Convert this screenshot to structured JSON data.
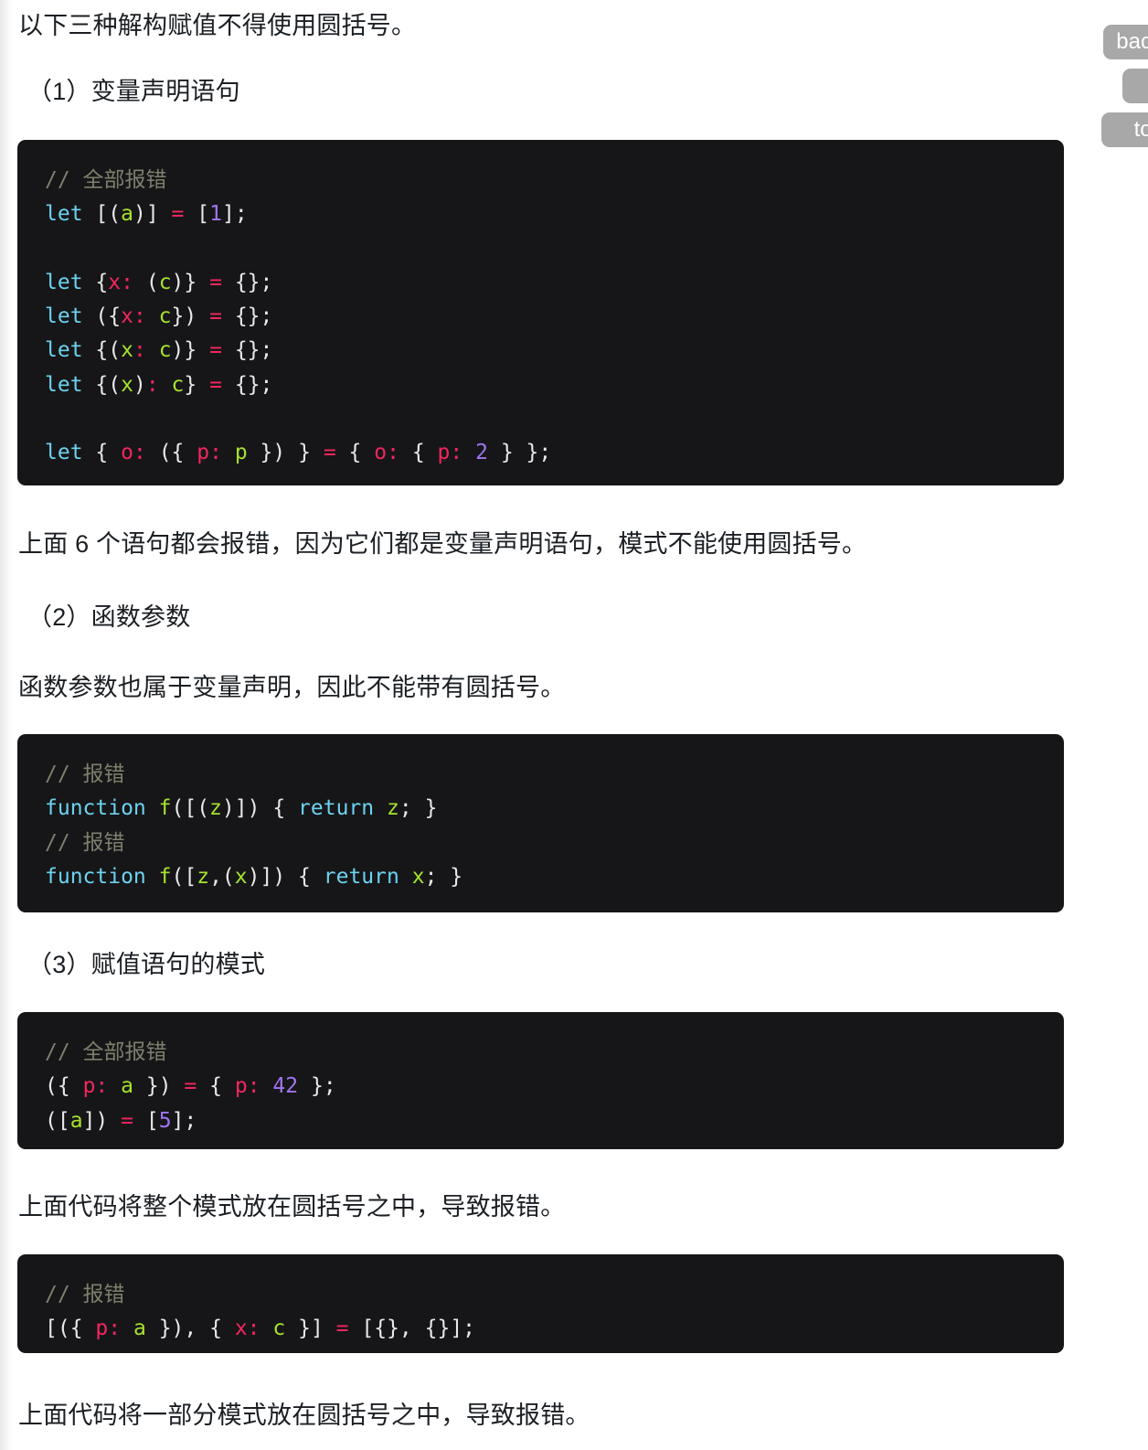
{
  "page": {
    "intro": "以下三种解构赋值不得使用圆括号。",
    "section1_heading": "（1）变量声明语句",
    "para_after_code1": "上面 6 个语句都会报错，因为它们都是变量声明语句，模式不能使用圆括号。",
    "section2_heading": "（2）函数参数",
    "para_before_code2": "函数参数也属于变量声明，因此不能带有圆括号。",
    "section3_heading": "（3）赋值语句的模式",
    "para_after_code3": "上面代码将整个模式放在圆括号之中，导致报错。",
    "para_after_code4": "上面代码将一部分模式放在圆括号之中，导致报错。"
  },
  "code_blocks": {
    "block1": {
      "comment": "// 全部报错",
      "lines": [
        "let [(a)] = [1];",
        "",
        "let {x: (c)} = {};",
        "let ({x: c}) = {};",
        "let {(x: c)} = {};",
        "let {(x): c} = {};",
        "",
        "let { o: ({ p: p }) } = { o: { p: 2 } };"
      ]
    },
    "block2": {
      "comment1": "// 报错",
      "line1": "function f([(z)]) { return z; }",
      "comment2": "// 报错",
      "line2": "function f([z,(x)]) { return x; }"
    },
    "block3": {
      "comment": "// 全部报错",
      "lines": [
        "({ p: a }) = { p: 42 };",
        "([a]) = [5];"
      ]
    },
    "block4": {
      "comment": "// 报错",
      "line1": "[({ p: a }), { x: c }] = [{}, {}];"
    }
  },
  "float_buttons": [
    {
      "label": "back",
      "name": "back-button"
    },
    {
      "label": "",
      "name": "middle-button"
    },
    {
      "label": "top",
      "name": "top-button"
    }
  ],
  "colors": {
    "page_bg": "#ffffff",
    "text": "#1b1f23",
    "code_bg": "#161618",
    "code_text": "#e6e6e6",
    "token_comment": "#7f7f6e",
    "token_keyword": "#6cd2f0",
    "token_property": "#f2265f",
    "token_value": "#a6e22e",
    "token_number": "#a075f0",
    "button_bg": "#a8a8a8"
  }
}
